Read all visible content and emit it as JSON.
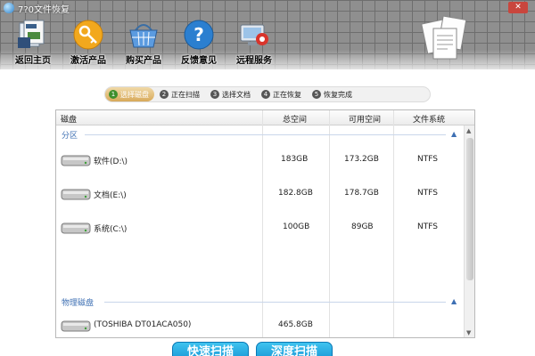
{
  "window": {
    "title": "7?0文件恢复",
    "close_label": "✕"
  },
  "toolbar": [
    {
      "label": "返回主页",
      "icon": "home-documents-icon"
    },
    {
      "label": "激活产品",
      "icon": "key-icon"
    },
    {
      "label": "购买产品",
      "icon": "basket-icon"
    },
    {
      "label": "反馈意见",
      "icon": "help-icon"
    },
    {
      "label": "远程服务",
      "icon": "remote-service-icon"
    }
  ],
  "steps": [
    {
      "num": "1",
      "label": "选择磁盘",
      "active": true
    },
    {
      "num": "2",
      "label": "正在扫描",
      "active": false
    },
    {
      "num": "3",
      "label": "选择文档",
      "active": false
    },
    {
      "num": "4",
      "label": "正在恢复",
      "active": false
    },
    {
      "num": "5",
      "label": "恢复完成",
      "active": false
    }
  ],
  "table": {
    "columns": [
      "磁盘",
      "总空间",
      "可用空间",
      "文件系统"
    ],
    "groups": [
      {
        "name": "分区",
        "rows": [
          {
            "disk": "软件(D:\\)",
            "total": "183GB",
            "free": "173.2GB",
            "fs": "NTFS"
          },
          {
            "disk": "文档(E:\\)",
            "total": "182.8GB",
            "free": "178.7GB",
            "fs": "NTFS"
          },
          {
            "disk": "系统(C:\\)",
            "total": "100GB",
            "free": "89GB",
            "fs": "NTFS"
          }
        ]
      },
      {
        "name": "物理磁盘",
        "rows": [
          {
            "disk": "(TOSHIBA DT01ACA050)",
            "total": "465.8GB",
            "free": "",
            "fs": ""
          }
        ]
      }
    ]
  },
  "buttons": {
    "quick_scan": "快速扫描",
    "deep_scan": "深度扫描"
  },
  "colors": {
    "accent": "#0e8dd0",
    "group_text": "#3d6fb3",
    "active_step": "#d8a95a"
  }
}
